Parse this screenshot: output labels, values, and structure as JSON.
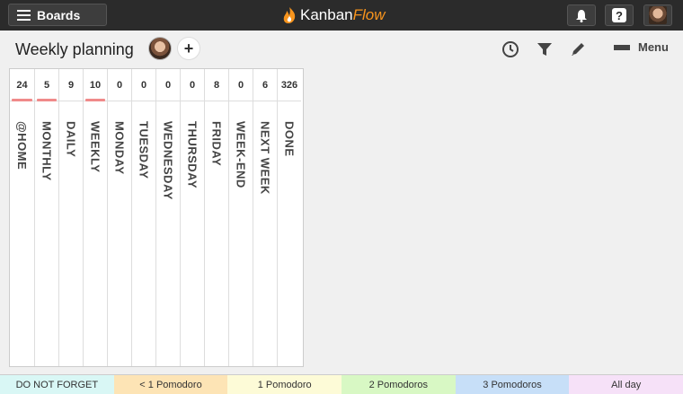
{
  "topbar": {
    "boards_label": "Boards",
    "logo_part1": "Kanban",
    "logo_part2": "Flow"
  },
  "board": {
    "title": "Weekly planning",
    "add_label": "+",
    "menu_label": "Menu"
  },
  "columns": [
    {
      "name": "@HOME",
      "count": "24",
      "over_limit": true
    },
    {
      "name": "MONTHLY",
      "count": "5",
      "over_limit": true
    },
    {
      "name": "DAILY",
      "count": "9",
      "over_limit": false
    },
    {
      "name": "WEEKLY",
      "count": "10",
      "over_limit": true
    },
    {
      "name": "MONDAY",
      "count": "0",
      "over_limit": false
    },
    {
      "name": "TUESDAY",
      "count": "0",
      "over_limit": false
    },
    {
      "name": "WEDNESDAY",
      "count": "0",
      "over_limit": false
    },
    {
      "name": "THURSDAY",
      "count": "0",
      "over_limit": false
    },
    {
      "name": "FRIDAY",
      "count": "8",
      "over_limit": false
    },
    {
      "name": "WEEK-END",
      "count": "0",
      "over_limit": false
    },
    {
      "name": "NEXT WEEK",
      "count": "6",
      "over_limit": false
    },
    {
      "name": "DONE",
      "count": "326",
      "over_limit": false
    }
  ],
  "legend": [
    {
      "label": "DO NOT FORGET",
      "color": "#d9f7f5"
    },
    {
      "label": "< 1 Pomodoro",
      "color": "#fde4b5"
    },
    {
      "label": "1 Pomodoro",
      "color": "#fdfbd7"
    },
    {
      "label": "2 Pomodoros",
      "color": "#d8f8c4"
    },
    {
      "label": "3 Pomodoros",
      "color": "#c7dff8"
    },
    {
      "label": "All day",
      "color": "#f6e1f8"
    }
  ],
  "icons": [
    "menu-icon",
    "kanbanflow-logo-icon",
    "bell-icon",
    "help-icon",
    "user-avatar",
    "clock-icon",
    "filter-icon",
    "pencil-icon"
  ]
}
